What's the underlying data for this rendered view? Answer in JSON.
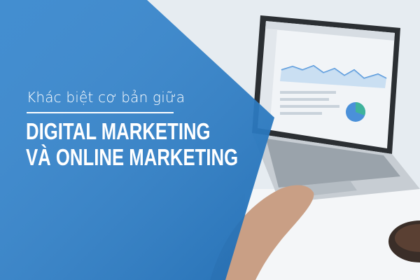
{
  "banner": {
    "subtitle": "Khác biệt cơ bản giữa",
    "headline_line1": "DIGITAL MARKETING",
    "headline_line2": "VÀ ONLINE MARKETING"
  },
  "colors": {
    "overlay_blue": "#1f78c8",
    "text": "#ffffff",
    "laptop_body": "#2b2f33",
    "chart_line": "#4a90d9",
    "pie_green": "#3fb39b"
  },
  "illustration": {
    "photo": "laptop-with-analytics-dashboard",
    "props": [
      "hand",
      "coffee-cup"
    ]
  }
}
